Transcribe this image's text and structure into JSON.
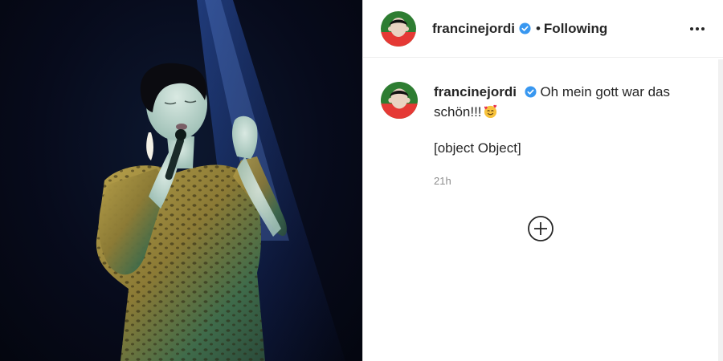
{
  "post": {
    "author": {
      "username": "francinejordi",
      "verified": true,
      "follow_status": "Following",
      "separator": "•"
    },
    "caption": "Oh mein gott war das schön!!!",
    "caption_emoji": "smiling-face-with-hearts",
    "extra_line": "[object Object]",
    "timestamp": "21h"
  },
  "icons": {
    "verified": "verified-badge-icon",
    "more": "more-options-icon",
    "load_more": "plus-circle-icon"
  },
  "colors": {
    "verified_blue": "#3897f0",
    "text": "#262626",
    "muted": "#8e8e8e",
    "avatar_red": "#e53935",
    "avatar_green": "#2e7d32"
  }
}
